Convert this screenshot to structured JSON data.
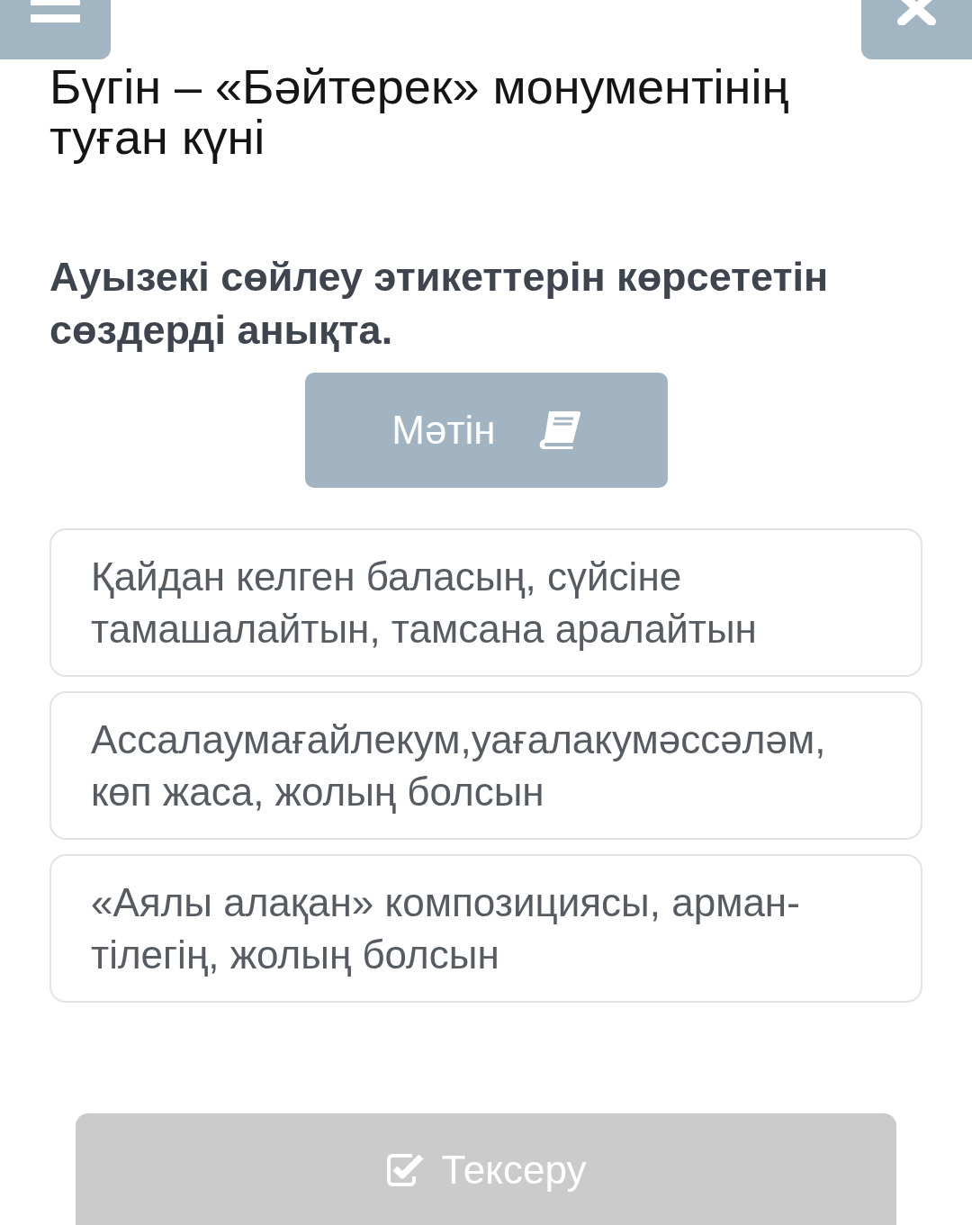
{
  "title": "Бүгін – «Бәйтерек» монументінің туған күні",
  "question": "Ауызекі сөйлеу этикеттерін көрсететін сөздерді анықта.",
  "text_button": {
    "label": "Мәтін"
  },
  "options": [
    {
      "text": "Қайдан келген баласың, сүйсіне тамашалайтын, тамсана аралайтын",
      "selected": false
    },
    {
      "text": "Ассалаумағайлекум,уағалакумәссәләм, көп жаса, жолың болсын",
      "selected": false
    },
    {
      "text": "«Аялы алақан» композициясы, арман-тілегің, жолың болсын",
      "selected": false
    }
  ],
  "check_button": {
    "label": "Тексеру",
    "disabled": true
  }
}
